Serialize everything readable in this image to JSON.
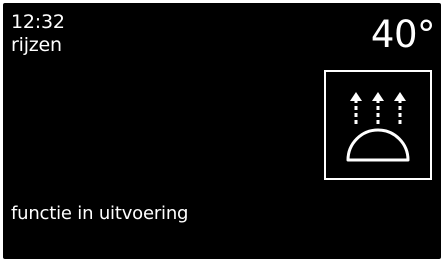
{
  "display": {
    "time": "12:32",
    "mode": "rijzen",
    "temperature": "40°",
    "status": "functie in uitvoering",
    "program_icon": "rising-dough-icon"
  },
  "colors": {
    "background": "#000000",
    "foreground": "#ffffff"
  }
}
